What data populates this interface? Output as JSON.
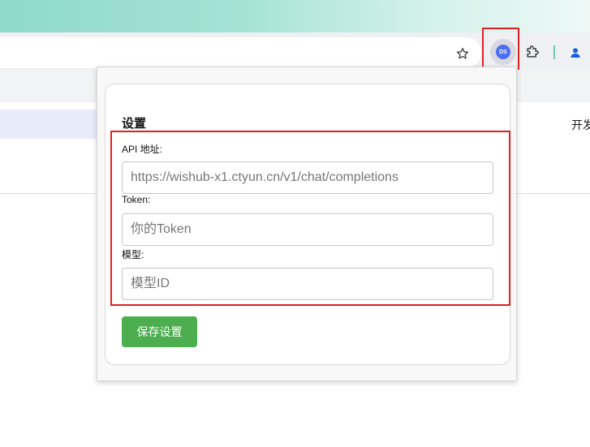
{
  "browser": {
    "extension_badge_text": "DS"
  },
  "page": {
    "right_text": "开发"
  },
  "settings": {
    "title": "设置",
    "api_url": {
      "label": "API 地址:",
      "placeholder": "https://wishub-x1.ctyun.cn/v1/chat/completions",
      "value": ""
    },
    "token": {
      "label": "Token:",
      "placeholder": "你的Token",
      "value": ""
    },
    "model": {
      "label": "模型:",
      "placeholder": "模型ID",
      "value": ""
    },
    "save_label": "保存设置"
  },
  "colors": {
    "save_button": "#4cae4f",
    "highlight": "#e02020",
    "extension_icon": "#4e6ef2"
  },
  "icons": {
    "star": "star-icon",
    "extension": "ds-extension-icon",
    "puzzle": "puzzle-icon",
    "profile": "profile-icon"
  }
}
